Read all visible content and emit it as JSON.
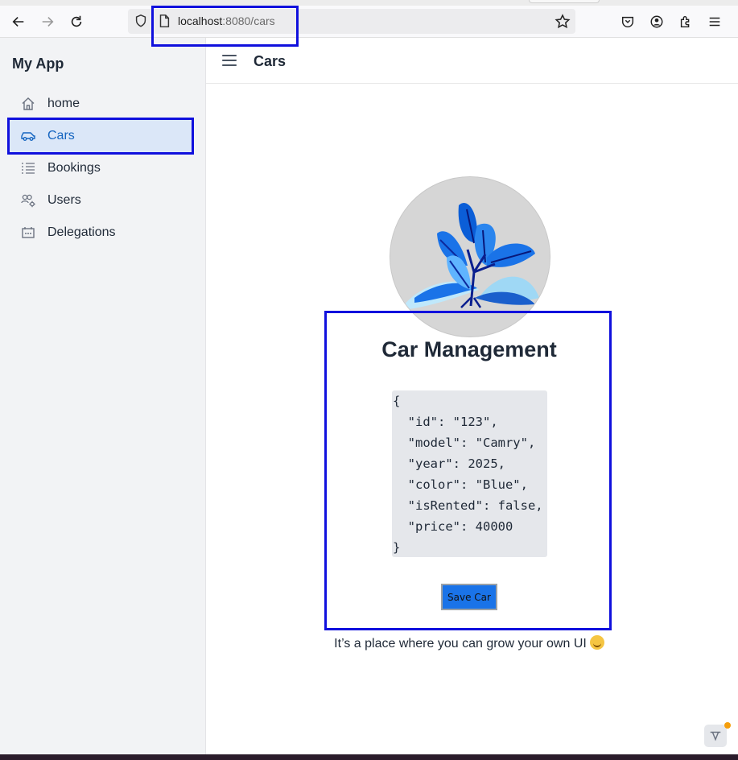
{
  "browser": {
    "url_host": "localhost",
    "url_path": ":8080/cars"
  },
  "sidebar": {
    "app_title": "My App",
    "items": [
      {
        "label": "home",
        "icon": "home-icon",
        "active": false
      },
      {
        "label": "Cars",
        "icon": "car-icon",
        "active": true
      },
      {
        "label": "Bookings",
        "icon": "list-icon",
        "active": false
      },
      {
        "label": "Users",
        "icon": "users-gear-icon",
        "active": false
      },
      {
        "label": "Delegations",
        "icon": "calendar-icon",
        "active": false
      }
    ]
  },
  "header": {
    "title": "Cars"
  },
  "card": {
    "title": "Car Management",
    "json_lines": [
      "{",
      "  \"id\": \"123\",",
      "  \"model\": \"Camry\",",
      "  \"year\": 2025,",
      "  \"color\": \"Blue\",",
      "  \"isRented\": false,",
      "  \"price\": 40000",
      "}"
    ],
    "save_label": "Save Car"
  },
  "footer": {
    "tagline": "It’s a place where you can grow your own UI"
  },
  "colors": {
    "accent": "#1565c0",
    "button": "#1a73e8",
    "highlight": "#1010dd"
  }
}
